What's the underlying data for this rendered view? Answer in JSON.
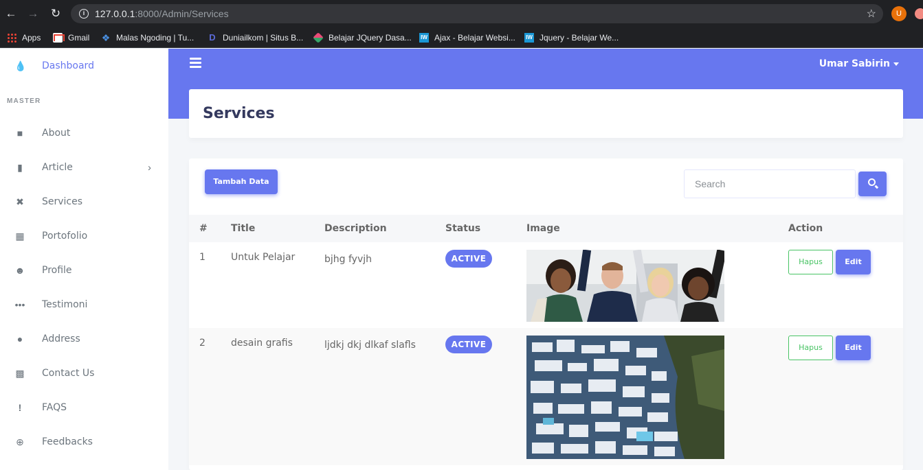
{
  "browser": {
    "url_host": "127.0.0.1",
    "url_rest": ":8000/Admin/Services",
    "profile_initial": "U",
    "bookmarks": [
      {
        "label": "Apps",
        "icon": "apps-grid-icon"
      },
      {
        "label": "Gmail",
        "icon": "gmail-icon"
      },
      {
        "label": "Malas Ngoding | Tu...",
        "icon": "code-icon"
      },
      {
        "label": "Duniailkom | Situs B...",
        "icon": "duniailkom-icon"
      },
      {
        "label": "Belajar JQuery Dasa...",
        "icon": "jquery-icon"
      },
      {
        "label": "Ajax - Belajar Websi...",
        "icon": "iw-icon"
      },
      {
        "label": "Jquery - Belajar We...",
        "icon": "iw-icon"
      }
    ]
  },
  "sidebar": {
    "brand": {
      "label": "Dashboard",
      "icon": "fire-icon"
    },
    "section_header": "MASTER",
    "items": [
      {
        "label": "About",
        "icon": "briefcase-icon"
      },
      {
        "label": "Article",
        "icon": "file-icon",
        "has_submenu": true
      },
      {
        "label": "Services",
        "icon": "tools-icon"
      },
      {
        "label": "Portofolio",
        "icon": "th-large-icon"
      },
      {
        "label": "Profile",
        "icon": "user-icon"
      },
      {
        "label": "Testimoni",
        "icon": "ellipsis-icon"
      },
      {
        "label": "Address",
        "icon": "map-marker-icon"
      },
      {
        "label": "Contact Us",
        "icon": "address-card-icon"
      },
      {
        "label": "FAQS",
        "icon": "exclamation-icon"
      },
      {
        "label": "Feedbacks",
        "icon": "plus-circle-icon"
      }
    ]
  },
  "topbar": {
    "user_name": "Umar Sabirin"
  },
  "page": {
    "title": "Services"
  },
  "toolbar": {
    "add_label": "Tambah Data",
    "search_placeholder": "Search"
  },
  "table": {
    "headers": [
      "#",
      "Title",
      "Description",
      "Status",
      "Image",
      "Action"
    ],
    "rows": [
      {
        "no": "1",
        "title": "Untuk Pelajar",
        "description": "bjhg fyvjh",
        "status": "ACTIVE",
        "image": "group-people-photo",
        "delete_label": "Hapus",
        "edit_label": "Edit"
      },
      {
        "no": "2",
        "title": "desain grafis",
        "description": "ljdkj dkj dlkaf slafls",
        "status": "ACTIVE",
        "image": "aerial-city-photo",
        "delete_label": "Hapus",
        "edit_label": "Edit"
      }
    ]
  },
  "colors": {
    "primary": "#6777ef",
    "success": "#47c363",
    "text": "#34395e",
    "chrome": "#202124"
  }
}
